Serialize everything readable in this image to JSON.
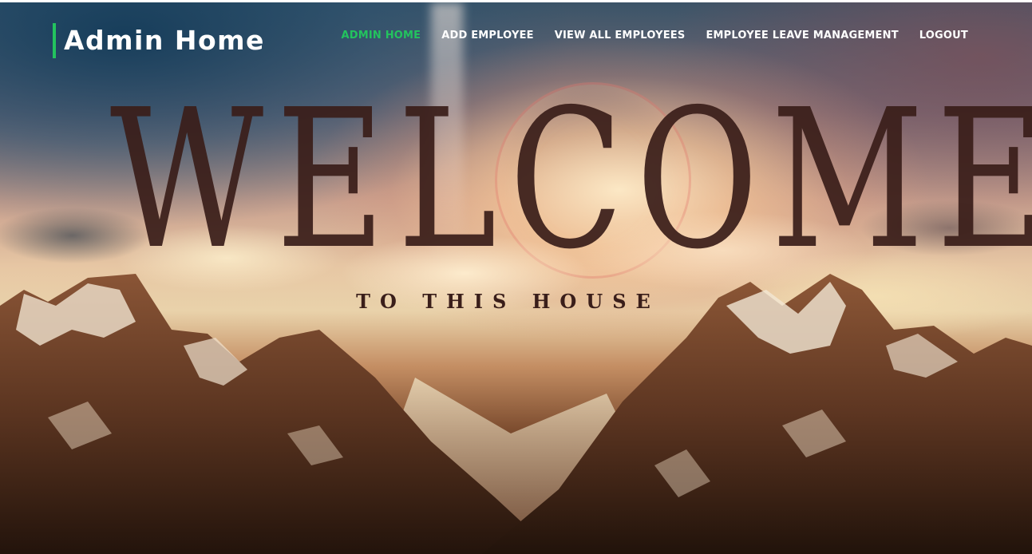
{
  "navbar": {
    "brand": "Admin Home",
    "brand_accent_color": "#23c35e",
    "links": [
      {
        "label": "ADMIN HOME",
        "active": true
      },
      {
        "label": "ADD EMPLOYEE",
        "active": false
      },
      {
        "label": "VIEW ALL EMPLOYEES",
        "active": false
      },
      {
        "label": "EMPLOYEE LEAVE MANAGEMENT",
        "active": false
      },
      {
        "label": "LOGOUT",
        "active": false
      }
    ],
    "active_color": "#23c35e"
  },
  "hero": {
    "title": "WELCOME",
    "subtitle": "TO THIS HOUSE",
    "text_color": "#3a1e1a"
  }
}
